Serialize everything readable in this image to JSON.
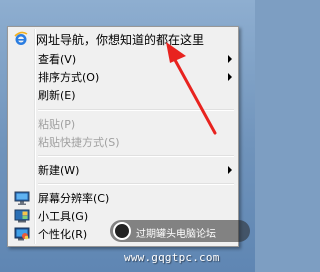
{
  "menu": {
    "items": [
      {
        "label": "网址导航，你想知道的都在这里",
        "icon": "ie-icon",
        "enabled": true
      },
      {
        "label": "查看(V)",
        "submenu": true,
        "enabled": true
      },
      {
        "label": "排序方式(O)",
        "submenu": true,
        "enabled": true
      },
      {
        "label": "刷新(E)",
        "enabled": true
      },
      {
        "label": "粘贴(P)",
        "enabled": false
      },
      {
        "label": "粘贴快捷方式(S)",
        "enabled": false
      },
      {
        "label": "新建(W)",
        "submenu": true,
        "enabled": true
      },
      {
        "label": "屏幕分辨率(C)",
        "icon": "display-icon",
        "enabled": true
      },
      {
        "label": "小工具(G)",
        "icon": "gadgets-icon",
        "enabled": true
      },
      {
        "label": "个性化(R)",
        "icon": "personalize-icon",
        "enabled": true
      }
    ]
  },
  "watermark": {
    "text": "过期罐头电脑论坛",
    "url": "www.gqgtpc.com"
  },
  "colors": {
    "annotation_arrow": "#e8231f",
    "menu_background": "#f0f0f0",
    "disabled_text": "#a0a0a0"
  }
}
